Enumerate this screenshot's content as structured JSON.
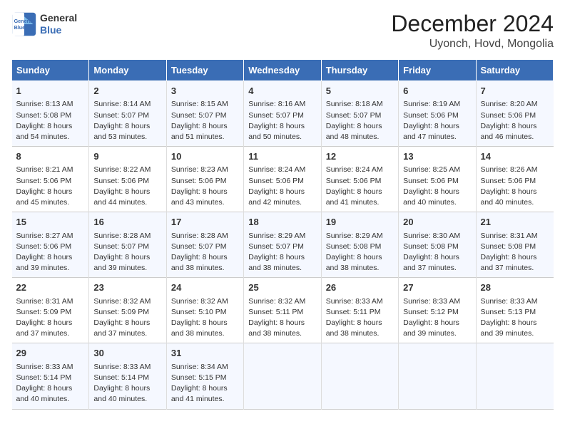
{
  "header": {
    "logo_line1": "General",
    "logo_line2": "Blue",
    "month_year": "December 2024",
    "location": "Uyonch, Hovd, Mongolia"
  },
  "days_of_week": [
    "Sunday",
    "Monday",
    "Tuesday",
    "Wednesday",
    "Thursday",
    "Friday",
    "Saturday"
  ],
  "weeks": [
    [
      {
        "day": 1,
        "sunrise": "8:13 AM",
        "sunset": "5:08 PM",
        "daylight": "8 hours and 54 minutes."
      },
      {
        "day": 2,
        "sunrise": "8:14 AM",
        "sunset": "5:07 PM",
        "daylight": "8 hours and 53 minutes."
      },
      {
        "day": 3,
        "sunrise": "8:15 AM",
        "sunset": "5:07 PM",
        "daylight": "8 hours and 51 minutes."
      },
      {
        "day": 4,
        "sunrise": "8:16 AM",
        "sunset": "5:07 PM",
        "daylight": "8 hours and 50 minutes."
      },
      {
        "day": 5,
        "sunrise": "8:18 AM",
        "sunset": "5:07 PM",
        "daylight": "8 hours and 48 minutes."
      },
      {
        "day": 6,
        "sunrise": "8:19 AM",
        "sunset": "5:06 PM",
        "daylight": "8 hours and 47 minutes."
      },
      {
        "day": 7,
        "sunrise": "8:20 AM",
        "sunset": "5:06 PM",
        "daylight": "8 hours and 46 minutes."
      }
    ],
    [
      {
        "day": 8,
        "sunrise": "8:21 AM",
        "sunset": "5:06 PM",
        "daylight": "8 hours and 45 minutes."
      },
      {
        "day": 9,
        "sunrise": "8:22 AM",
        "sunset": "5:06 PM",
        "daylight": "8 hours and 44 minutes."
      },
      {
        "day": 10,
        "sunrise": "8:23 AM",
        "sunset": "5:06 PM",
        "daylight": "8 hours and 43 minutes."
      },
      {
        "day": 11,
        "sunrise": "8:24 AM",
        "sunset": "5:06 PM",
        "daylight": "8 hours and 42 minutes."
      },
      {
        "day": 12,
        "sunrise": "8:24 AM",
        "sunset": "5:06 PM",
        "daylight": "8 hours and 41 minutes."
      },
      {
        "day": 13,
        "sunrise": "8:25 AM",
        "sunset": "5:06 PM",
        "daylight": "8 hours and 40 minutes."
      },
      {
        "day": 14,
        "sunrise": "8:26 AM",
        "sunset": "5:06 PM",
        "daylight": "8 hours and 40 minutes."
      }
    ],
    [
      {
        "day": 15,
        "sunrise": "8:27 AM",
        "sunset": "5:06 PM",
        "daylight": "8 hours and 39 minutes."
      },
      {
        "day": 16,
        "sunrise": "8:28 AM",
        "sunset": "5:07 PM",
        "daylight": "8 hours and 39 minutes."
      },
      {
        "day": 17,
        "sunrise": "8:28 AM",
        "sunset": "5:07 PM",
        "daylight": "8 hours and 38 minutes."
      },
      {
        "day": 18,
        "sunrise": "8:29 AM",
        "sunset": "5:07 PM",
        "daylight": "8 hours and 38 minutes."
      },
      {
        "day": 19,
        "sunrise": "8:29 AM",
        "sunset": "5:08 PM",
        "daylight": "8 hours and 38 minutes."
      },
      {
        "day": 20,
        "sunrise": "8:30 AM",
        "sunset": "5:08 PM",
        "daylight": "8 hours and 37 minutes."
      },
      {
        "day": 21,
        "sunrise": "8:31 AM",
        "sunset": "5:08 PM",
        "daylight": "8 hours and 37 minutes."
      }
    ],
    [
      {
        "day": 22,
        "sunrise": "8:31 AM",
        "sunset": "5:09 PM",
        "daylight": "8 hours and 37 minutes."
      },
      {
        "day": 23,
        "sunrise": "8:32 AM",
        "sunset": "5:09 PM",
        "daylight": "8 hours and 37 minutes."
      },
      {
        "day": 24,
        "sunrise": "8:32 AM",
        "sunset": "5:10 PM",
        "daylight": "8 hours and 38 minutes."
      },
      {
        "day": 25,
        "sunrise": "8:32 AM",
        "sunset": "5:11 PM",
        "daylight": "8 hours and 38 minutes."
      },
      {
        "day": 26,
        "sunrise": "8:33 AM",
        "sunset": "5:11 PM",
        "daylight": "8 hours and 38 minutes."
      },
      {
        "day": 27,
        "sunrise": "8:33 AM",
        "sunset": "5:12 PM",
        "daylight": "8 hours and 39 minutes."
      },
      {
        "day": 28,
        "sunrise": "8:33 AM",
        "sunset": "5:13 PM",
        "daylight": "8 hours and 39 minutes."
      }
    ],
    [
      {
        "day": 29,
        "sunrise": "8:33 AM",
        "sunset": "5:14 PM",
        "daylight": "8 hours and 40 minutes."
      },
      {
        "day": 30,
        "sunrise": "8:33 AM",
        "sunset": "5:14 PM",
        "daylight": "8 hours and 40 minutes."
      },
      {
        "day": 31,
        "sunrise": "8:34 AM",
        "sunset": "5:15 PM",
        "daylight": "8 hours and 41 minutes."
      },
      null,
      null,
      null,
      null
    ]
  ]
}
